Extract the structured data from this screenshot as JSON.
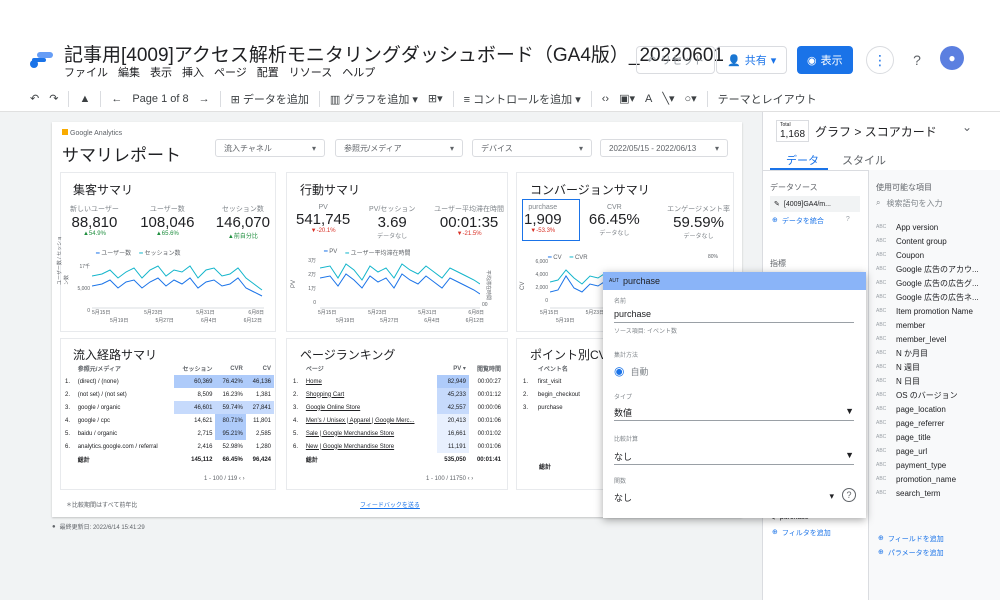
{
  "app": {
    "title": "記事用[4009]アクセス解析モニタリングダッシュボード（GA4版）_20220601",
    "menus": [
      "ファイル",
      "編集",
      "表示",
      "挿入",
      "ページ",
      "配置",
      "リソース",
      "ヘルプ"
    ],
    "reset_label": "リセット",
    "share_label": "共有",
    "view_label": "表示",
    "avatar": "●"
  },
  "toolbar": {
    "page_label": "Page 1 of 8",
    "add_data": "データを追加",
    "add_chart": "グラフを追加",
    "add_control": "コントロールを追加",
    "theme": "テーマとレイアウト"
  },
  "report": {
    "ga_label": "Google Analytics",
    "title": "サマリレポート",
    "controls": {
      "channel": "流入チャネル",
      "source": "参照元/メディア",
      "device": "デバイス",
      "daterange": "2022/05/15 - 2022/06/13"
    },
    "acq": {
      "title": "集客サマリ",
      "cards": [
        {
          "label": "新しいユーザー",
          "value": "88,810",
          "delta": "▲54.9%",
          "tone": "green"
        },
        {
          "label": "ユーザー数",
          "value": "108,046",
          "delta": "▲65.6%",
          "tone": "green"
        },
        {
          "label": "セッション数",
          "value": "146,070",
          "delta": "▲前自分比",
          "tone": "green"
        }
      ],
      "legend_a": "ユーザー数",
      "legend_b": "セッション数",
      "y_label": "ユーザー数 / セッション数",
      "y_ticks": [
        "17千",
        "5,000",
        "0"
      ],
      "x_ticks_top": [
        "5月15日",
        "5月23日",
        "5月31日",
        "6月8日"
      ],
      "x_ticks_bottom": [
        "5月19日",
        "5月27日",
        "6月4日",
        "6月12日"
      ]
    },
    "beh": {
      "title": "行動サマリ",
      "cards": [
        {
          "label": "PV",
          "value": "541,745",
          "delta": "▼-20.1%",
          "tone": "red"
        },
        {
          "label": "PV/セッション",
          "value": "3.69",
          "delta": "データなし",
          "tone": "grey"
        },
        {
          "label": "ユーザー平均滞在時間",
          "value": "00:01:35",
          "delta": "▼-21.5%",
          "tone": "red"
        }
      ],
      "legend_a": "PV",
      "legend_b": "ユーザー平均滞在時間",
      "y_label": "PV",
      "y_label_r": "平均滞在時間",
      "y_ticks": [
        "3万",
        "2万",
        "1万",
        "0"
      ],
      "y_right": "00",
      "x_ticks_top": [
        "5月15日",
        "5月23日",
        "5月31日",
        "6月8日"
      ],
      "x_ticks_bottom": [
        "5月19日",
        "5月27日",
        "6月4日",
        "6月12日"
      ]
    },
    "conv": {
      "title": "コンバージョンサマリ",
      "cards": [
        {
          "label": "purchase",
          "value": "1,909",
          "delta": "▼-53.3%",
          "tone": "red"
        },
        {
          "label": "CVR",
          "value": "66.45%",
          "delta": "データなし",
          "tone": "grey"
        },
        {
          "label": "エンゲージメント率",
          "value": "59.59%",
          "delta": "データなし",
          "tone": "grey"
        }
      ],
      "legend_a": "CV",
      "legend_b": "CVR",
      "y_label": "CV",
      "y_ticks": [
        "6,000",
        "4,000",
        "2,000",
        "0"
      ],
      "y_right": "80%",
      "x_ticks": [
        "5月15日",
        "5月23日"
      ],
      "x_ticks_bottom": [
        "5月19日"
      ]
    },
    "inflow": {
      "title": "流入経路サマリ",
      "headers": [
        "参照元/メディア",
        "セッション",
        "CVR",
        "CV"
      ],
      "rows": [
        [
          "1.",
          "(direct) / (none)",
          "60,369",
          "76.42%",
          "46,136"
        ],
        [
          "2.",
          "(not set) / (not set)",
          "8,509",
          "16.23%",
          "1,381"
        ],
        [
          "3.",
          "google / organic",
          "46,601",
          "59.74%",
          "27,841"
        ],
        [
          "4.",
          "google / cpc",
          "14,621",
          "80.71%",
          "11,801"
        ],
        [
          "5.",
          "baidu / organic",
          "2,715",
          "95.21%",
          "2,585"
        ],
        [
          "6.",
          "analytics.google.com / referral",
          "2,416",
          "52.98%",
          "1,280"
        ]
      ],
      "total": [
        "総計",
        "145,112",
        "66.45%",
        "96,424"
      ],
      "pager": "1 - 100 / 119"
    },
    "pages": {
      "title": "ページランキング",
      "headers": [
        "ページ",
        "PV ▾",
        "閲覧時間"
      ],
      "rows": [
        [
          "1.",
          "Home",
          "82,949",
          "00:00:27"
        ],
        [
          "2.",
          "Shopping Cart",
          "45,233",
          "00:01:12"
        ],
        [
          "3.",
          "Google Online Store",
          "42,557",
          "00:00:06"
        ],
        [
          "4.",
          "Men's / Unisex | Apparel | Google Merc...",
          "20,413",
          "00:01:06"
        ],
        [
          "5.",
          "Sale | Google Merchandise Store",
          "16,661",
          "00:01:02"
        ],
        [
          "6.",
          "New | Google Merchandise Store",
          "11,191",
          "00:01:06"
        ]
      ],
      "total": [
        "総計",
        "535,050",
        "00:01:41"
      ],
      "pager": "1 - 100 / 11750"
    },
    "points": {
      "title": "ポイント別CV",
      "headers": [
        "イベント名"
      ],
      "rows": [
        [
          "1.",
          "first_visit"
        ],
        [
          "2.",
          "begin_checkout"
        ],
        [
          "3.",
          "purchase"
        ]
      ],
      "total": "総計"
    },
    "note": "＊比較期間はすべて前年比",
    "feedback": "フィードバックを送る",
    "updated": "最終更新日: 2022/6/14 15:41:29"
  },
  "right_panel": {
    "total_label": "Total",
    "total_value": "1,168",
    "breadcrumb": "グラフ > スコアカード",
    "tab_data": "データ",
    "tab_style": "スタイル",
    "ds_header": "データソース",
    "ds_name": "[4009]GA4/m...",
    "merge": "データを統合",
    "metric_header": "指標",
    "available_header": "使用可能な項目",
    "search_placeholder": "検索語句を入力",
    "fields": [
      "App version",
      "Content group",
      "Coupon",
      "Google 広告のアカウ...",
      "Google 広告の広告グ...",
      "Google 広告の広告ネ...",
      "Item promotion Name",
      "member",
      "member_level",
      "N か月目",
      "N 週目",
      "N 日目",
      "OS のバージョン",
      "page_location",
      "page_referrer",
      "page_title",
      "page_url",
      "payment_type",
      "promotion_name",
      "search_term"
    ],
    "abc": "ABC",
    "purchase_chip": "purchase",
    "add_filter": "フィルタを追加",
    "add_field": "フィールドを追加",
    "add_param": "パラメータを追加"
  },
  "popup": {
    "aut": "AUT",
    "header": "purchase",
    "name_label": "名前",
    "name_value": "purchase",
    "source_label": "ソース項目: イベント数",
    "agg_label": "集計方法",
    "agg_value": "自動",
    "type_label": "タイプ",
    "type_value": "数値",
    "comp_label": "比較計算",
    "comp_value": "なし",
    "func_label": "関数",
    "func_value": "なし"
  },
  "colors": {
    "accent": "#1a73e8",
    "teal": "#12b5cb",
    "highlight": "#aecbfa"
  }
}
